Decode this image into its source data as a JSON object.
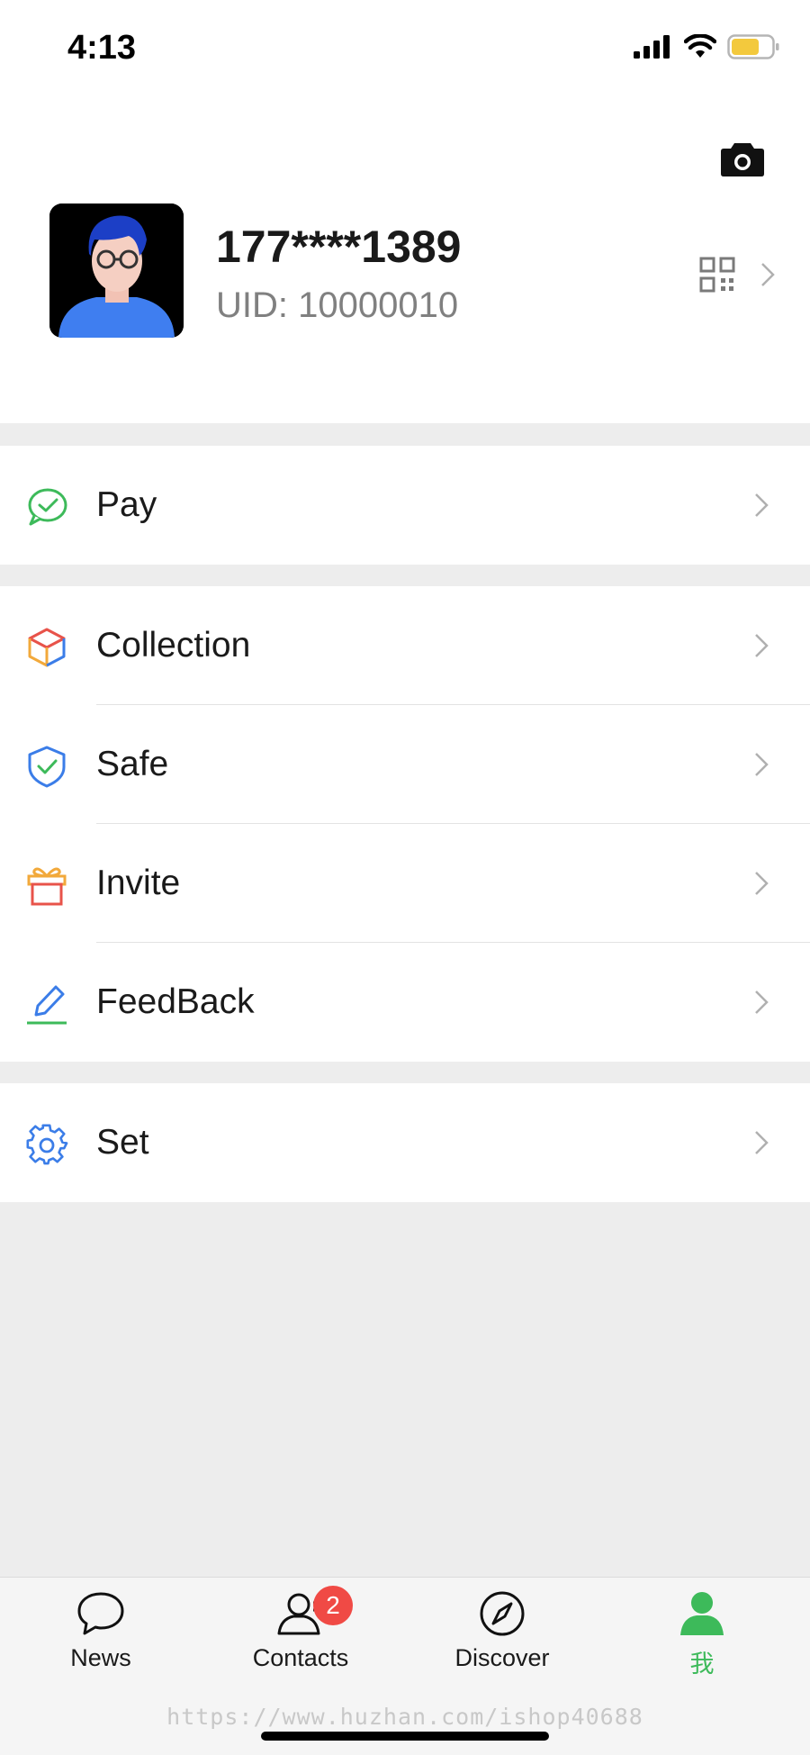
{
  "status_bar": {
    "time": "4:13"
  },
  "profile": {
    "phone": "177****1389",
    "uid": "UID: 10000010"
  },
  "menu": {
    "groups": [
      [
        {
          "label": "Pay",
          "icon": "pay-icon"
        }
      ],
      [
        {
          "label": "Collection",
          "icon": "collection-cube-icon"
        },
        {
          "label": "Safe",
          "icon": "shield-icon"
        },
        {
          "label": "Invite",
          "icon": "gift-icon"
        },
        {
          "label": "FeedBack",
          "icon": "pencil-icon"
        }
      ],
      [
        {
          "label": "Set",
          "icon": "gear-icon"
        }
      ]
    ]
  },
  "tabbar": {
    "tabs": [
      {
        "label": "News",
        "icon": "chat-bubble-icon"
      },
      {
        "label": "Contacts",
        "icon": "contacts-icon",
        "badge": "2"
      },
      {
        "label": "Discover",
        "icon": "compass-icon"
      },
      {
        "label": "我",
        "icon": "person-icon",
        "active": true
      }
    ]
  },
  "watermark": "https://www.huzhan.com/ishop40688",
  "colors": {
    "accent": "#3dba5a",
    "badge": "#f04a45",
    "background": "#ededed"
  }
}
